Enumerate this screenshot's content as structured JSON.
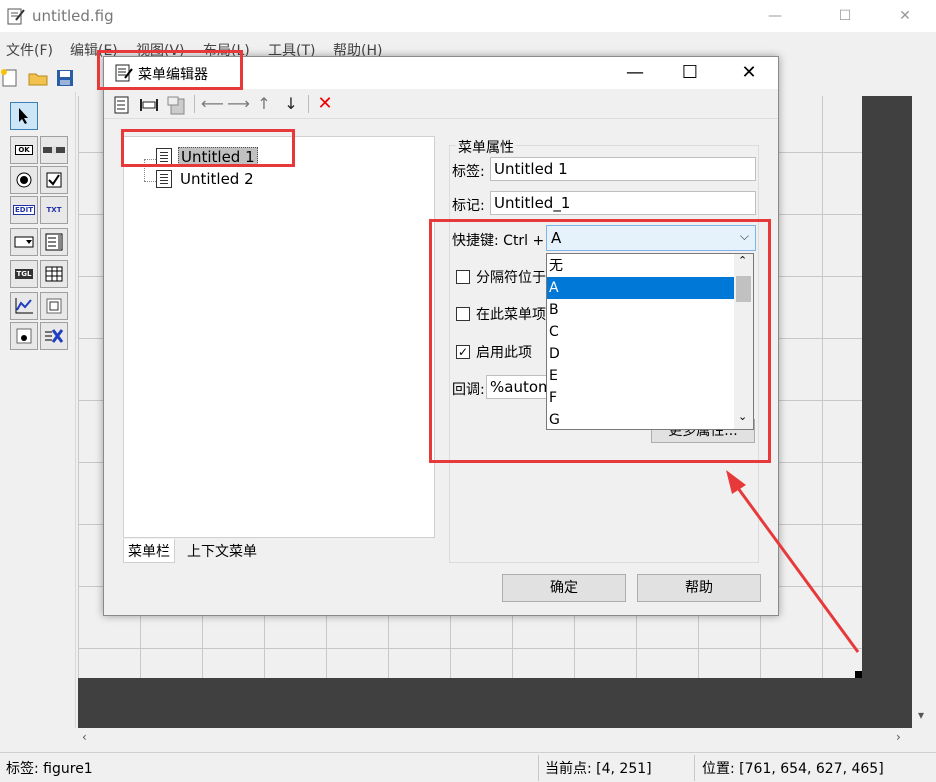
{
  "window": {
    "title": "untitled.fig",
    "minimize": "—",
    "maximize": "☐",
    "close": "✕"
  },
  "menubar": [
    "文件(F)",
    "编辑(E)",
    "视图(V)",
    "布局(L)",
    "工具(T)",
    "帮助(H)"
  ],
  "palette": [
    "OK",
    "TXT",
    "EDIT",
    "TGL"
  ],
  "dialog": {
    "title": "菜单编辑器",
    "minimize": "—",
    "maximize": "☐",
    "close": "✕",
    "tree": [
      {
        "label": "Untitled 1",
        "selected": true
      },
      {
        "label": "Untitled 2",
        "selected": false
      }
    ],
    "tabs": [
      "菜单栏",
      "上下文菜单"
    ],
    "props": {
      "group_title": "菜单属性",
      "label_lbl": "标签:",
      "label_val": "Untitled 1",
      "tag_lbl": "标记:",
      "tag_val": "Untitled_1",
      "accel_lbl": "快捷键: Ctrl +",
      "accel_val": "A",
      "separator_lbl": "分隔符位于",
      "checked_lbl": "在此菜单项",
      "enabled_lbl": "启用此项",
      "callback_lbl": "回调:",
      "callback_val": "%autom",
      "more_btn": "更多属性..."
    },
    "dropdown": {
      "options": [
        "无",
        "A",
        "B",
        "C",
        "D",
        "E",
        "F",
        "G"
      ],
      "selected": "A"
    },
    "ok_btn": "确定",
    "help_btn": "帮助"
  },
  "statusbar": {
    "tag": "标签: figure1",
    "current_point": "当前点:  [4, 251]",
    "position": "位置: [761, 654, 627, 465]"
  },
  "colors": {
    "selection": "#0078d7",
    "annotation": "#e8393a",
    "canvas_dark": "#404040"
  }
}
